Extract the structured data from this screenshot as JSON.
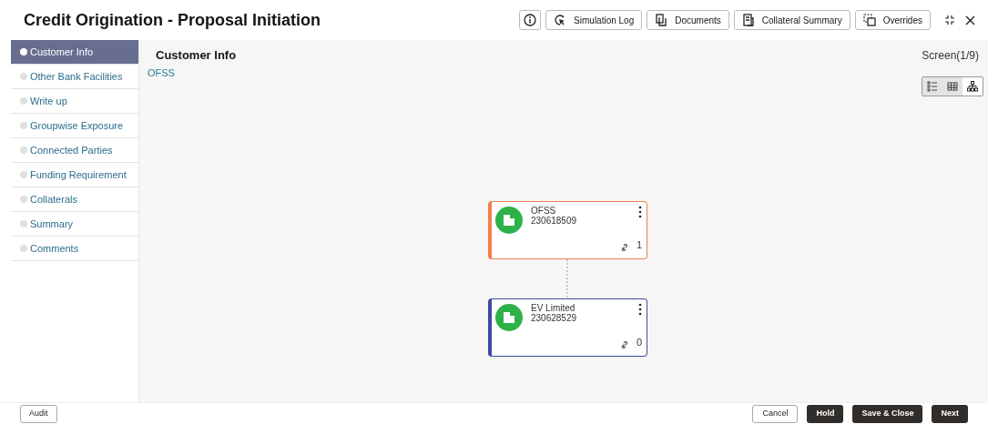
{
  "window": {
    "title": "Credit Origination - Proposal Initiation"
  },
  "toolbar": [
    {
      "kind": "info"
    },
    {
      "kind": "simulation",
      "label": "Simulation Log"
    },
    {
      "kind": "documents",
      "label": "Documents"
    },
    {
      "kind": "collateral",
      "label": "Collateral Summary"
    },
    {
      "kind": "overrides",
      "label": "Overrides"
    }
  ],
  "steps": [
    {
      "label": "Customer Info",
      "selected": true
    },
    {
      "label": "Other Bank Facilities",
      "selected": false
    },
    {
      "label": "Write up",
      "selected": false
    },
    {
      "label": "Groupwise Exposure",
      "selected": false
    },
    {
      "label": "Connected Parties",
      "selected": false
    },
    {
      "label": "Funding Requirement",
      "selected": false
    },
    {
      "label": "Collaterals",
      "selected": false
    },
    {
      "label": "Summary",
      "selected": false
    },
    {
      "label": "Comments",
      "selected": false
    }
  ],
  "content": {
    "heading": "Customer Info",
    "subtitle": "OFSS",
    "screen": "Screen(1/9)",
    "views": [
      {
        "kind": "list",
        "selected": false
      },
      {
        "kind": "grid",
        "selected": false
      },
      {
        "kind": "tree",
        "selected": true
      }
    ],
    "nodes": [
      {
        "name": "OFSS",
        "id": "230618509",
        "count": "1",
        "color": "#f07f4f"
      },
      {
        "name": "EV Limited",
        "id": "230628529",
        "count": "0",
        "color": "#3f4aa0"
      }
    ]
  },
  "footer": {
    "left": [
      "Audit"
    ],
    "right": [
      {
        "label": "Cancel",
        "kind": "secondary"
      },
      {
        "label": "Hold",
        "kind": "primary"
      },
      {
        "label": "Save & Close",
        "kind": "primary"
      },
      {
        "label": "Next",
        "kind": "primary"
      }
    ]
  }
}
